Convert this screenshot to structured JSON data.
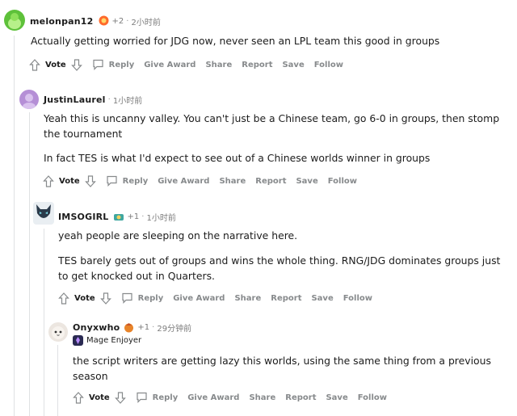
{
  "comments": [
    {
      "username": "melonpan12",
      "award_count": "+2",
      "time": "2小时前",
      "body": [
        "Actually getting worried for JDG now, never seen an LPL team this good in groups"
      ],
      "actions": {
        "vote": "Vote",
        "reply": "Reply",
        "give_award": "Give Award",
        "share": "Share",
        "report": "Report",
        "save": "Save",
        "follow": "Follow"
      }
    },
    {
      "username": "JustinLaurel",
      "time": "1小时前",
      "body": [
        "Yeah this is uncanny valley. You can't just be a Chinese team, go 6-0 in groups, then stomp",
        "the tournament",
        "In fact TES is what I'd expect to see out of a Chinese worlds winner in groups"
      ],
      "actions": {
        "vote": "Vote",
        "reply": "Reply",
        "give_award": "Give Award",
        "share": "Share",
        "report": "Report",
        "save": "Save",
        "follow": "Follow"
      }
    },
    {
      "username": "IMSOGIRL",
      "award_count": "+1",
      "time": "1小时前",
      "body": [
        "yeah people are sleeping on the narrative here.",
        "TES barely gets out of groups and wins the whole thing. RNG/JDG dominates groups just",
        "to get knocked out in Quarters."
      ],
      "actions": {
        "vote": "Vote",
        "reply": "Reply",
        "give_award": "Give Award",
        "share": "Share",
        "report": "Report",
        "save": "Save",
        "follow": "Follow"
      }
    },
    {
      "username": "Onyxwho",
      "award_count": "+1",
      "time": "29分钟前",
      "flair": "Mage Enjoyer",
      "body": [
        "the script writers are getting lazy this worlds, using the same thing from a previous",
        "season"
      ],
      "actions": {
        "vote": "Vote",
        "reply": "Reply",
        "give_award": "Give Award",
        "share": "Share",
        "report": "Report",
        "save": "Save",
        "follow": "Follow"
      }
    }
  ],
  "colors": {
    "text": "#1c1c1c",
    "meta": "#7c7c7c",
    "action": "#878a8c",
    "thread": "#dfe1e3"
  }
}
